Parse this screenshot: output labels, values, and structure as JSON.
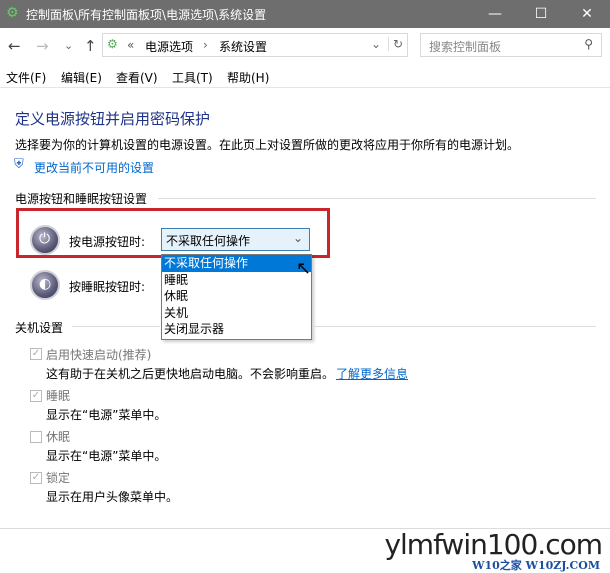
{
  "window": {
    "title": "控制面板\\所有控制面板项\\电源选项\\系统设置",
    "minimize": "—",
    "maximize": "☐",
    "close": "✕"
  },
  "nav": {
    "back": "←",
    "forward": "→",
    "recent": "⌄",
    "up": "↑",
    "breadcrumb_prefix": "«",
    "crumbs": [
      "电源选项",
      "系统设置"
    ],
    "crumb_sep": "›",
    "dropdown": "⌄",
    "refresh": "↻",
    "search_placeholder": "搜索控制面板",
    "search_icon": "⚲"
  },
  "menu": [
    "文件(F)",
    "编辑(E)",
    "查看(V)",
    "工具(T)",
    "帮助(H)"
  ],
  "page": {
    "title": "定义电源按钮并启用密码保护",
    "desc": "选择要为你的计算机设置的电源设置。在此页上对设置所做的更改将应用于你所有的电源计划。",
    "change_link": "更改当前不可用的设置",
    "section_buttons": "电源按钮和睡眠按钮设置",
    "power_label": "按电源按钮时:",
    "power_value": "不采取任何操作",
    "sleep_label": "按睡眠按钮时:",
    "options": [
      "不采取任何操作",
      "睡眠",
      "休眠",
      "关机",
      "关闭显示器"
    ],
    "section_shutdown": "关机设置",
    "shutdown_items": [
      {
        "label": "启用快速启动(推荐)",
        "checked": true,
        "desc": "这有助于在关机之后更快地启动电脑。不会影响重启。",
        "link": "了解更多信息"
      },
      {
        "label": "睡眠",
        "checked": true,
        "desc": "显示在“电源”菜单中。"
      },
      {
        "label": "休眠",
        "checked": false,
        "desc": "显示在“电源”菜单中。"
      },
      {
        "label": "锁定",
        "checked": true,
        "desc": "显示在用户头像菜单中。"
      }
    ]
  },
  "watermark": {
    "main": "ylmfwin100.com",
    "sub": "W10之家 W10ZJ.COM"
  },
  "colors": {
    "highlight": "#c8262c",
    "selection": "#0078d7",
    "link": "#0066cc",
    "title": "#1e3287"
  }
}
